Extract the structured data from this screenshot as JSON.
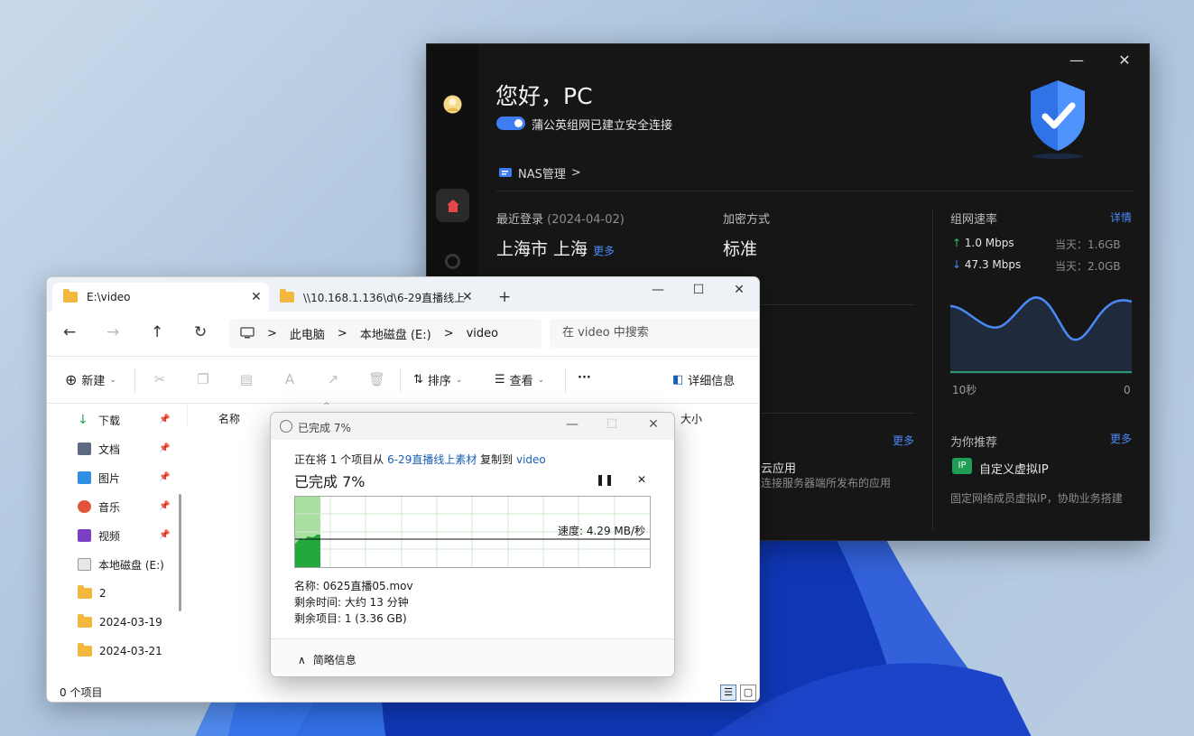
{
  "nas_app": {
    "window_minimize": "—",
    "window_close": "✕",
    "greeting": "您好，PC",
    "connection_status": "蒲公英组网已建立安全连接",
    "nas_link": "NAS管理",
    "nas_chevron": ">",
    "last_login_label": "最近登录",
    "last_login_date": "(2024-04-02)",
    "last_login_location": "上海市 上海",
    "more": "更多",
    "encryption_label": "加密方式",
    "encryption_value": "标准",
    "network_speed_label": "组网速率",
    "details": "详情",
    "upload_speed": "1.0 Mbps",
    "upload_today": "当天：1.6GB",
    "download_speed": "47.3 Mbps",
    "download_today": "当天：2.0GB",
    "chart_axis_left": "10秒",
    "chart_axis_right": "0",
    "apps_more": "更多",
    "cloud_app_title": "云应用",
    "cloud_app_desc": "连接服务器端所发布的应用",
    "recommend_label": "为你推荐",
    "recommend_more": "更多",
    "ip_badge": "IP",
    "custom_ip_title": "自定义虚拟IP",
    "custom_ip_desc": "固定网络成员虚拟IP，协助业务搭建",
    "colors": {
      "accent": "#3d7cf2",
      "link": "#4a8af6",
      "upload": "#2fbf71",
      "download": "#4a8af6"
    }
  },
  "explorer": {
    "tabs": [
      {
        "label": "E:\\video",
        "close": "✕"
      },
      {
        "label": "\\\\10.168.1.136\\d\\6-29直播线上",
        "close": "✕"
      }
    ],
    "new_tab": "+",
    "window_min": "—",
    "window_max": "☐",
    "window_close": "✕",
    "nav_back": "←",
    "nav_forward": "→",
    "nav_up": "↑",
    "nav_refresh": "↻",
    "breadcrumb": [
      "此电脑",
      "本地磁盘 (E:)",
      "video"
    ],
    "breadcrumb_sep": ">",
    "search_placeholder": "在 video 中搜索",
    "new_label": "新建",
    "sort_label": "排序",
    "view_label": "查看",
    "more_label": "···",
    "details_pane_label": "详细信息",
    "nav_items": [
      {
        "label": "下载",
        "pinned": true
      },
      {
        "label": "文档",
        "pinned": true
      },
      {
        "label": "图片",
        "pinned": true
      },
      {
        "label": "音乐",
        "pinned": true
      },
      {
        "label": "视频",
        "pinned": true
      },
      {
        "label": "本地磁盘 (E:)",
        "pinned": false
      },
      {
        "label": "2",
        "pinned": false
      },
      {
        "label": "2024-03-19",
        "pinned": false
      },
      {
        "label": "2024-03-21",
        "pinned": false
      }
    ],
    "pin_glyph": "📌",
    "column_name": "名称",
    "column_size": "大小",
    "status_text": "0 个项目"
  },
  "copy_dialog": {
    "title": "已完成 7%",
    "min": "—",
    "max": "☐",
    "close": "✕",
    "line_prefix": "正在将 1 个项目从 ",
    "source": "6-29直播线上素材",
    "line_mid": " 复制到 ",
    "destination": "video",
    "progress_text": "已完成 7%",
    "progress_percent": 7,
    "pause": "❚❚",
    "cancel": "✕",
    "speed": "速度: 4.29 MB/秒",
    "file_name": "名称: 0625直播05.mov",
    "time_remaining": "剩余时间: 大约 13 分钟",
    "items_remaining": "剩余项目: 1 (3.36 GB)",
    "less_info": "简略信息",
    "less_chevron": "∧"
  }
}
